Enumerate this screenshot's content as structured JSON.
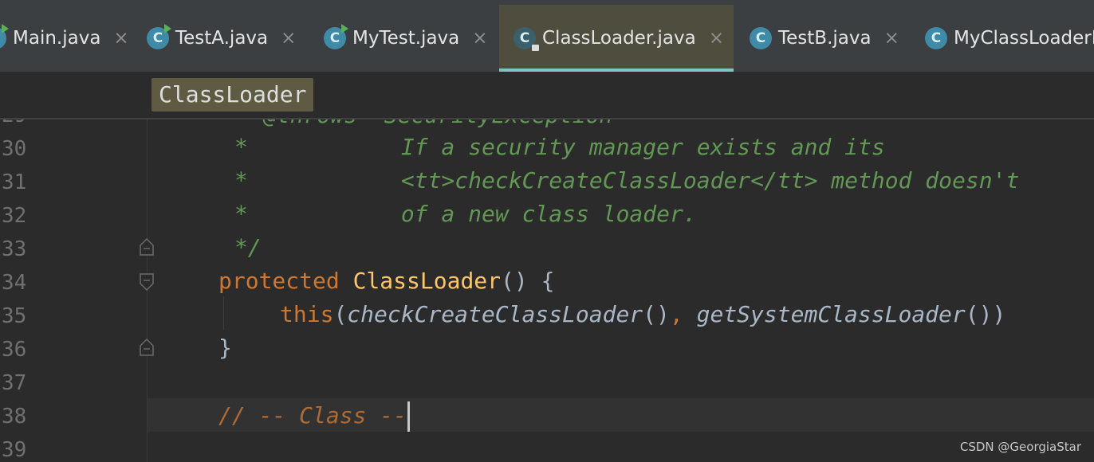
{
  "tabs": [
    {
      "label": "Main.java",
      "close": "×",
      "icon": "run-class-icon"
    },
    {
      "label": "TestA.java",
      "close": "×",
      "icon": "run-class-icon"
    },
    {
      "label": "MyTest.java",
      "close": "×",
      "icon": "run-class-icon"
    },
    {
      "label": "ClassLoader.java",
      "close": "×",
      "icon": "locked-class-icon"
    },
    {
      "label": "TestB.java",
      "close": "×",
      "icon": "class-icon"
    },
    {
      "label": "MyClassLoaderE",
      "close": "",
      "icon": "class-icon"
    }
  ],
  "icon_letter": "C",
  "breadcrumb": "ClassLoader",
  "lines": {
    "l29": {
      "num": "29",
      "text": "@throws  SecurityException"
    },
    "l30": {
      "num": "30",
      "star": "*",
      "text": "If a security manager exists and its"
    },
    "l31": {
      "num": "31",
      "star": "*",
      "text": "<tt>checkCreateClassLoader</tt> method doesn't"
    },
    "l32": {
      "num": "32",
      "star": "*",
      "text": "of a new class loader."
    },
    "l33": {
      "num": "33",
      "text": "*/"
    },
    "l34": {
      "num": "34",
      "kw": "protected",
      "fn": "ClassLoader",
      "rest": "() {"
    },
    "l35": {
      "num": "35",
      "kw": "this",
      "open": "(",
      "call1": "checkCreateClassLoader",
      "mid1": "()",
      "comma": ", ",
      "call2": "getSystemClassLoader",
      "mid2": "())"
    },
    "l36": {
      "num": "36",
      "text": "}"
    },
    "l37": {
      "num": "37"
    },
    "l38": {
      "num": "38",
      "text": "// -- Class --"
    },
    "l39": {
      "num": "39"
    }
  },
  "watermark": "CSDN @GeorgiaStar",
  "colors": {
    "accent_tab_underline": "#7fc4c4",
    "keyword": "#cc7832",
    "function": "#ffc66d",
    "doc_comment": "#629755"
  }
}
